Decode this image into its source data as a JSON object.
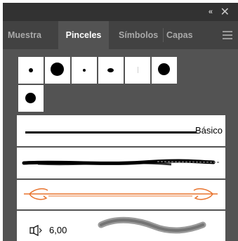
{
  "window": {
    "collapse_glyph": "«",
    "close_glyph": "✕"
  },
  "tabs": [
    {
      "label": "Muestra",
      "active": false
    },
    {
      "label": "Pinceles",
      "active": true
    },
    {
      "label": "Símbolos",
      "active": false
    },
    {
      "label": "Capas",
      "active": false
    }
  ],
  "brushes": {
    "basic_label": "Básico",
    "size_value": "6,00",
    "icons": {
      "menu": "hamburger-menu-icon",
      "size": "speaker-size-icon"
    }
  },
  "colors": {
    "panel_bg": "#535353",
    "titlebar_bg": "#323232",
    "tabbar_bg": "#424242",
    "arrow_brush": "#e8732d"
  }
}
